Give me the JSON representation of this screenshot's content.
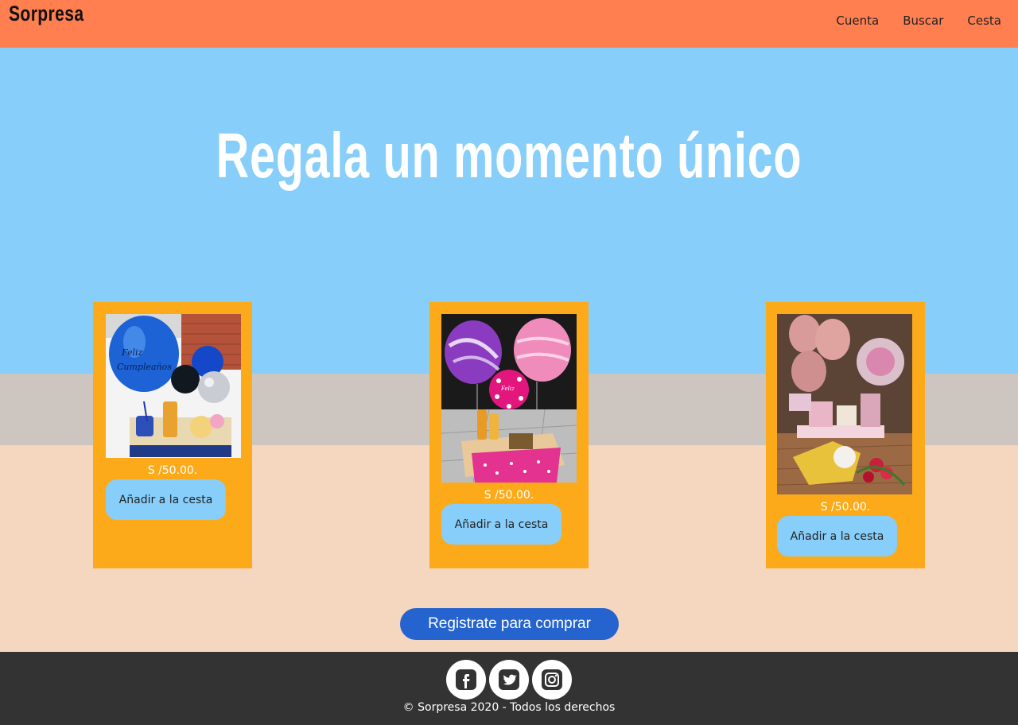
{
  "header": {
    "logo": "Sorpresa",
    "nav": [
      "Cuenta",
      "Buscar",
      "Cesta"
    ]
  },
  "hero": {
    "title": "Regala un momento único"
  },
  "products": [
    {
      "price": "S /50.00.",
      "button": "Añadir a la cesta",
      "image_icon": "gift-basket-blue-balloons-image"
    },
    {
      "price": "S /50.00.",
      "button": "Añadir a la cesta",
      "image_icon": "gift-basket-pink-purple-balloons-image"
    },
    {
      "price": "S /50.00.",
      "button": "Añadir a la cesta",
      "image_icon": "gift-arrangement-rose-gold-balloons-image"
    }
  ],
  "register_button": "Registrate para comprar",
  "footer": {
    "social": [
      "facebook-icon",
      "twitter-icon",
      "instagram-icon"
    ],
    "copyright": "© Sorpresa 2020 - Todos los derechos"
  },
  "colors": {
    "header": "#ff7f50",
    "hero": "#87cefa",
    "card": "#fcaa1a",
    "register": "#2563cf",
    "footer": "#333333"
  }
}
